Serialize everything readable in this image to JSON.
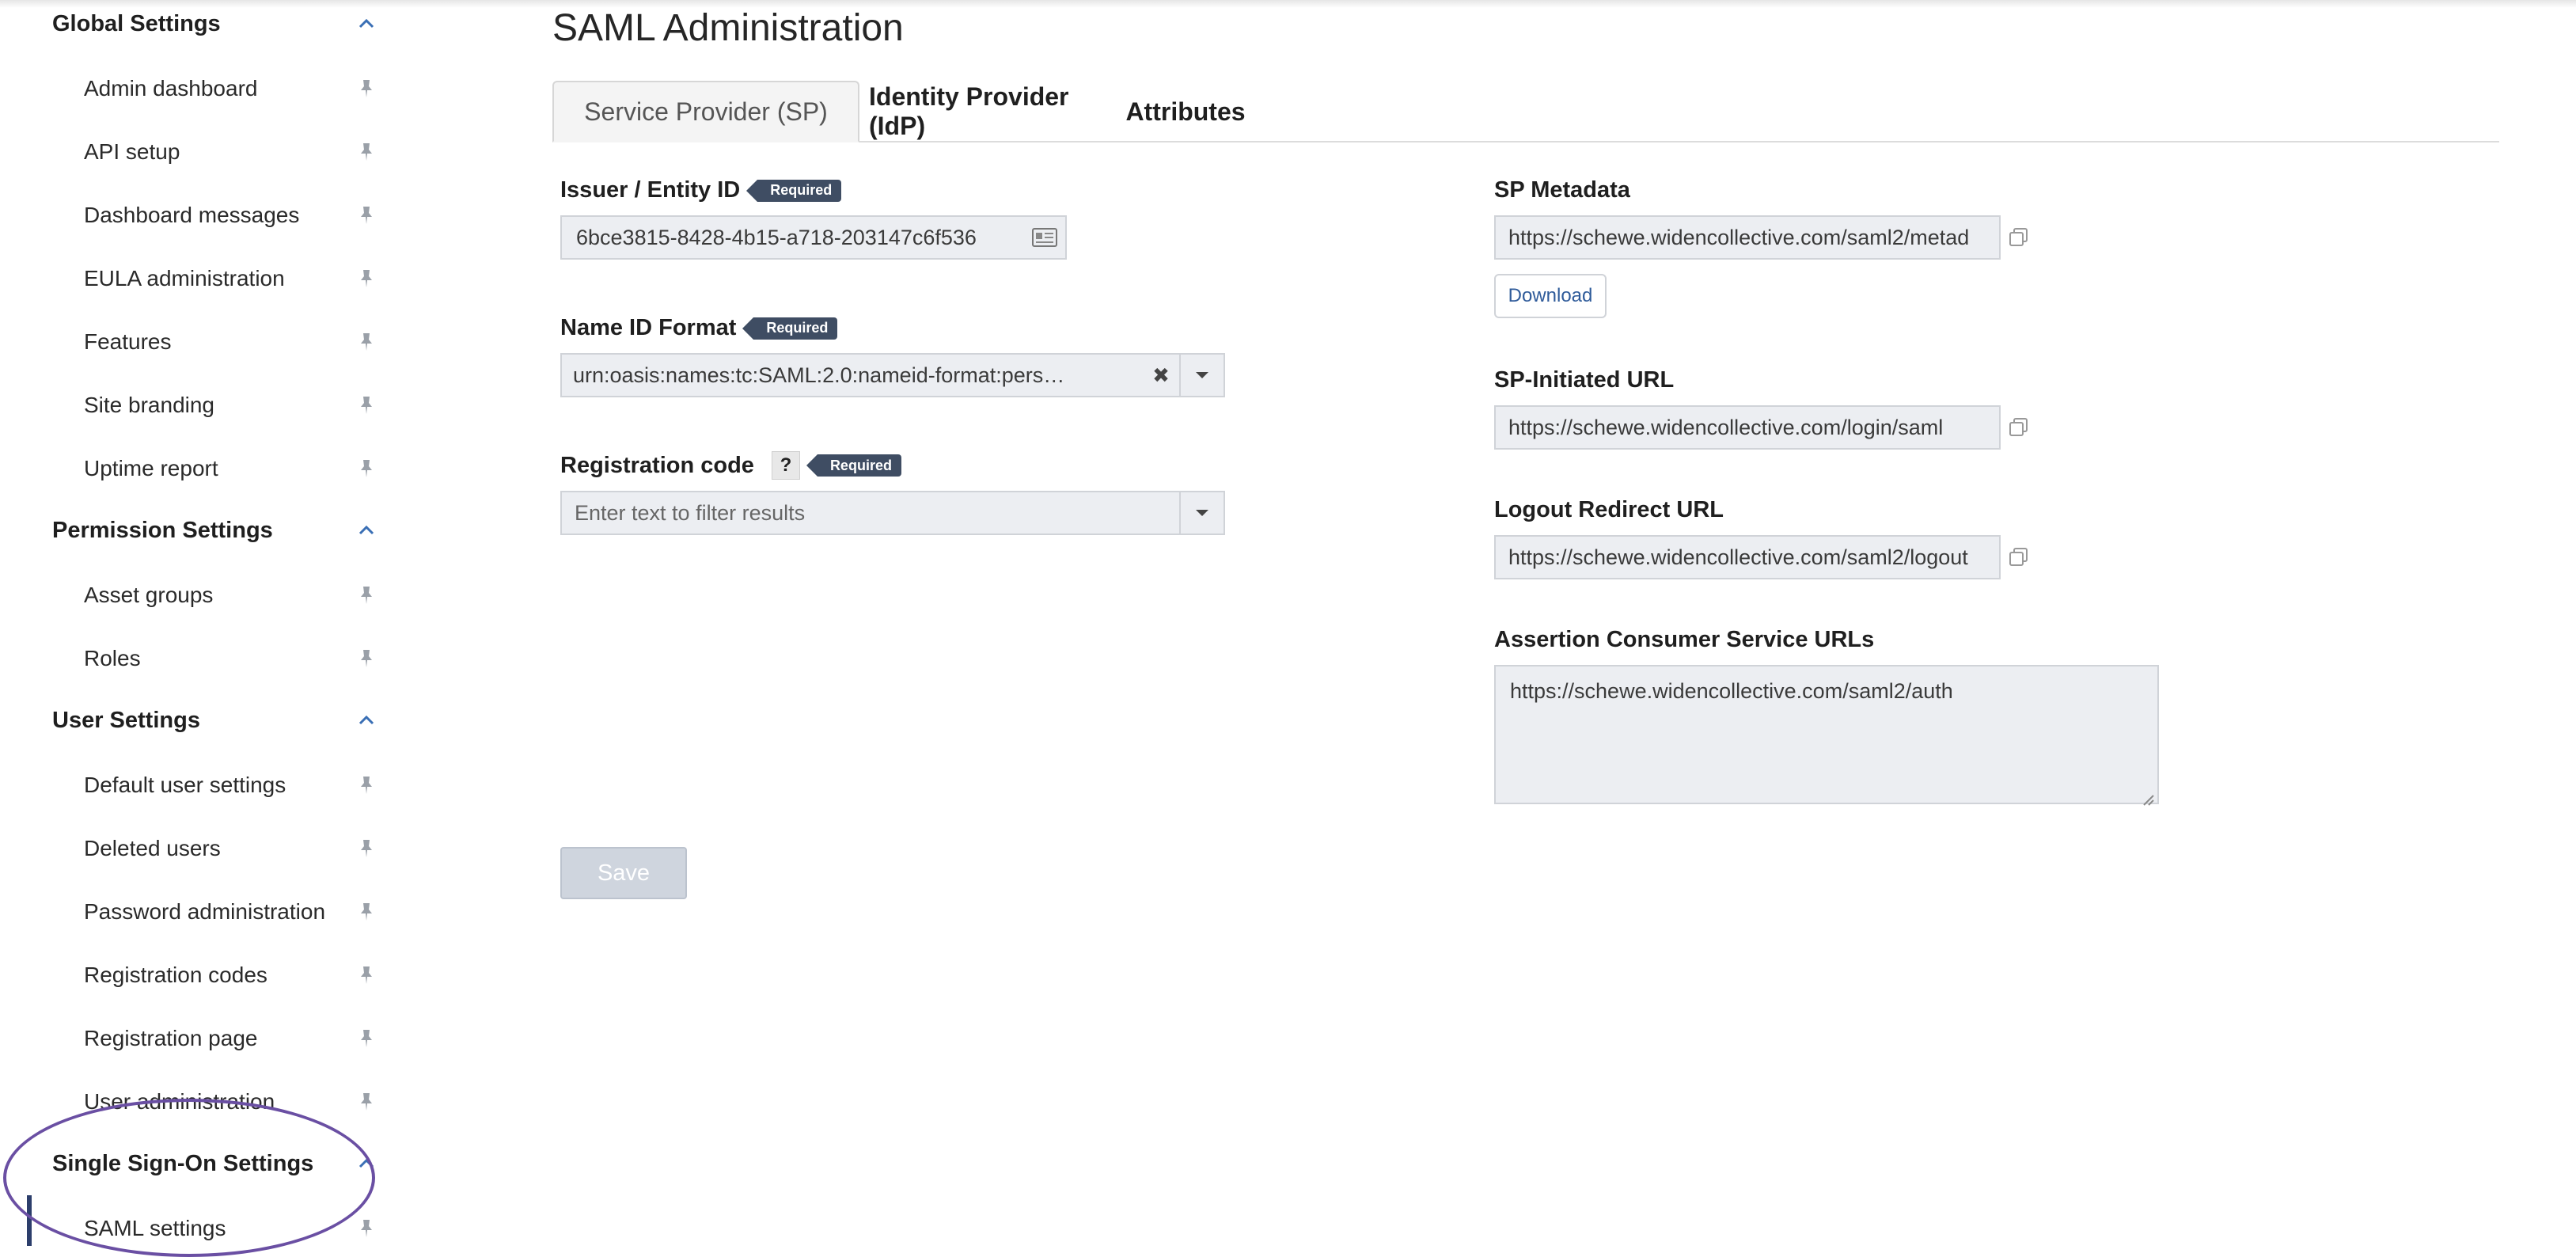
{
  "sidebar": {
    "sections": [
      {
        "title": "Global Settings",
        "items": [
          "Admin dashboard",
          "API setup",
          "Dashboard messages",
          "EULA administration",
          "Features",
          "Site branding",
          "Uptime report"
        ]
      },
      {
        "title": "Permission Settings",
        "items": [
          "Asset groups",
          "Roles"
        ]
      },
      {
        "title": "User Settings",
        "items": [
          "Default user settings",
          "Deleted users",
          "Password administration",
          "Registration codes",
          "Registration page",
          "User administration"
        ]
      },
      {
        "title": "Single Sign-On Settings",
        "items": [
          "SAML settings"
        ]
      }
    ],
    "active_item": "SAML settings"
  },
  "page": {
    "title": "SAML Administration"
  },
  "tabs": [
    {
      "label": "Service Provider (SP)",
      "active": true
    },
    {
      "label": "Identity Provider (IdP)",
      "active": false
    },
    {
      "label": "Attributes",
      "active": false
    }
  ],
  "required_badge": "Required",
  "form_left": {
    "issuer": {
      "label": "Issuer / Entity ID",
      "value": "6bce3815-8428-4b15-a718-203147c6f536",
      "icon": "id-card-icon"
    },
    "name_id_format": {
      "label": "Name ID Format",
      "value": "urn:oasis:names:tc:SAML:2.0:nameid-format:pers…",
      "clear": "✖"
    },
    "registration_code": {
      "label": "Registration code",
      "help": "?",
      "placeholder": "Enter text to filter results"
    }
  },
  "form_right": {
    "sp_metadata": {
      "label": "SP Metadata",
      "value": "https://schewe.widencollective.com/saml2/metad",
      "download_label": "Download"
    },
    "sp_initiated_url": {
      "label": "SP-Initiated URL",
      "value": "https://schewe.widencollective.com/login/saml"
    },
    "logout_redirect_url": {
      "label": "Logout Redirect URL",
      "value": "https://schewe.widencollective.com/saml2/logout"
    },
    "acs_urls": {
      "label": "Assertion Consumer Service URLs",
      "value": "https://schewe.widencollective.com/saml2/auth"
    }
  },
  "actions": {
    "save_label": "Save"
  },
  "colors": {
    "badge": "#3f4d63",
    "link": "#2f5b9a",
    "annotation": "#6a4fa3",
    "field_bg": "#eceef2"
  }
}
